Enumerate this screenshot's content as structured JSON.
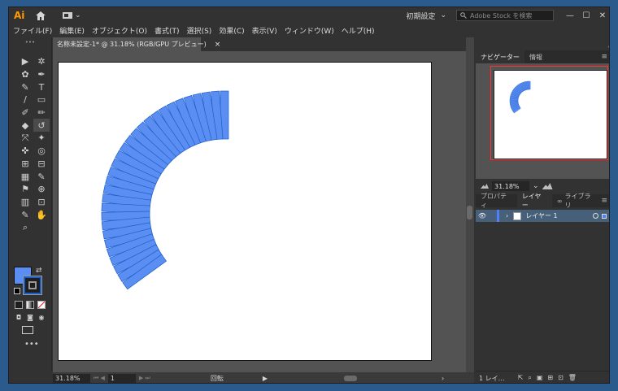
{
  "app": {
    "logo": "Ai",
    "workspace": "初期設定",
    "stock_placeholder": "Adobe Stock を検索",
    "window_buttons": [
      "—",
      "☐",
      "✕"
    ]
  },
  "menu": [
    "ファイル(F)",
    "編集(E)",
    "オブジェクト(O)",
    "書式(T)",
    "選択(S)",
    "効果(C)",
    "表示(V)",
    "ウィンドウ(W)",
    "ヘルプ(H)"
  ],
  "document": {
    "tab_title": "名称未設定-1* @ 31.18% (RGB/GPU プレビュー)",
    "tab_close": "×"
  },
  "tools": [
    "▶",
    "✲",
    "✿",
    "✒",
    "✎",
    "T",
    "/",
    "▭",
    "✐",
    "✏",
    "◆",
    "↺",
    "⤧",
    "✦",
    "✜",
    "◎",
    "⊞",
    "⊟",
    "▦",
    "✎",
    "⚑",
    "⊕",
    "▥",
    "⊡",
    "✎",
    "✋",
    "⌕",
    ""
  ],
  "colors": {
    "fill": "#5b8ef2",
    "stroke": "#1e1e1e",
    "accent": "#4f7fff",
    "artwork": "#5b8ef2",
    "artwork_stroke": "#1d5fc9"
  },
  "status": {
    "zoom": "31.18%",
    "artboard": "1",
    "mode": "回転",
    "arrow_right": "▶",
    "arrow_end": "›"
  },
  "right_panel": {
    "nav_tabs": [
      "ナビゲーター",
      "情報"
    ],
    "zoom": "31.18%",
    "layer_tabs": [
      "プロパティ",
      "レイヤー",
      "ライブラリ"
    ],
    "layers": [
      {
        "name": "レイヤー 1"
      }
    ],
    "footer_count": "1 レイ…"
  },
  "arc": {
    "count": 30,
    "start_angle_deg": 90,
    "end_angle_deg": 216
  }
}
